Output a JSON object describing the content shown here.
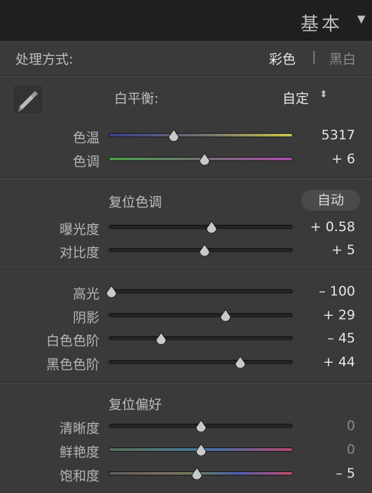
{
  "header": {
    "title": "基本",
    "collapse_icon": "triangle-down-icon"
  },
  "treatment": {
    "label": "处理方式:",
    "color": "彩色",
    "separator": "|",
    "bw": "黑白"
  },
  "wb": {
    "label": "白平衡:",
    "value": "自定",
    "eyedropper_icon": "eyedropper-icon",
    "stepper_icon": "updown-arrows-icon"
  },
  "sliders": {
    "temp": {
      "label": "色温",
      "value": "5317",
      "fraction": 0.35
    },
    "tint": {
      "label": "色调",
      "value": "+ 6",
      "fraction": 0.52
    },
    "exposure": {
      "label": "曝光度",
      "value": "+ 0.58",
      "fraction": 0.56
    },
    "contrast": {
      "label": "对比度",
      "value": "+ 5",
      "fraction": 0.52
    },
    "highlights": {
      "label": "高光",
      "value": "– 100",
      "fraction": 0.0
    },
    "shadows": {
      "label": "阴影",
      "value": "+ 29",
      "fraction": 0.64
    },
    "whites": {
      "label": "白色色阶",
      "value": "– 45",
      "fraction": 0.28
    },
    "blacks": {
      "label": "黑色色阶",
      "value": "+ 44",
      "fraction": 0.72
    },
    "clarity": {
      "label": "清晰度",
      "value": "0",
      "fraction": 0.5
    },
    "vibrance": {
      "label": "鲜艳度",
      "value": "0",
      "fraction": 0.5
    },
    "saturation": {
      "label": "饱和度",
      "value": "– 5",
      "fraction": 0.48
    }
  },
  "tone_group": {
    "reset_label": "复位色调",
    "auto_label": "自动"
  },
  "presence_group": {
    "reset_label": "复位偏好"
  }
}
